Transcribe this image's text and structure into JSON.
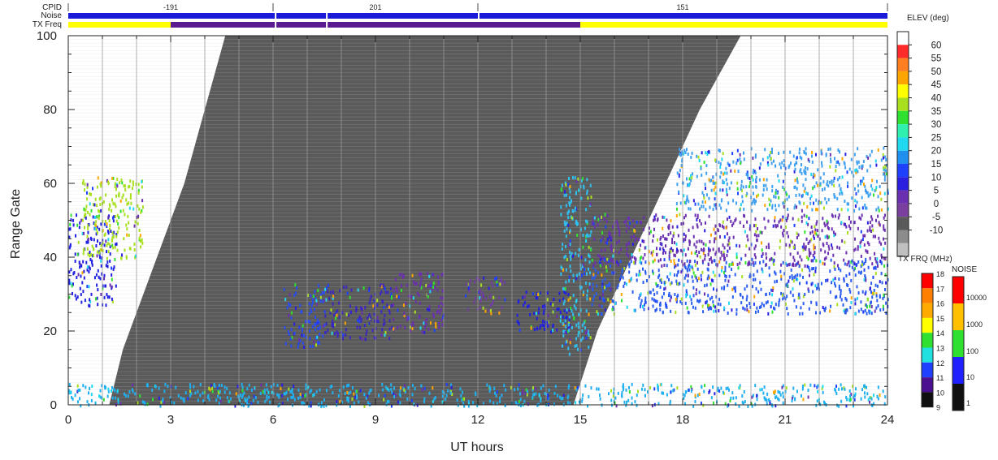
{
  "chart_data": {
    "type": "heatmap",
    "title": "",
    "xlabel": "UT hours",
    "ylabel": "Range Gate",
    "xlim": [
      0,
      24
    ],
    "ylim": [
      0,
      100
    ],
    "x_ticks": [
      "0",
      "3",
      "6",
      "9",
      "12",
      "15",
      "18",
      "21",
      "24"
    ],
    "y_ticks": [
      "0",
      "20",
      "40",
      "60",
      "80",
      "100"
    ],
    "grid": "vertical lines every hour",
    "status_strips": {
      "labels": [
        "CPID",
        "Noise",
        "TX Freq"
      ],
      "cpid_segments": [
        {
          "start": 0,
          "end": 6,
          "label": "-191"
        },
        {
          "start": 6,
          "end": 12,
          "label": "201"
        },
        {
          "start": 12,
          "end": 24,
          "label": "151"
        }
      ]
    },
    "gray_region": {
      "description_free": true,
      "left_edge": [
        [
          1.2,
          0
        ],
        [
          1.6,
          15
        ],
        [
          2.2,
          30
        ],
        [
          2.8,
          45
        ],
        [
          3.4,
          60
        ],
        [
          4.0,
          80
        ],
        [
          4.6,
          100
        ]
      ],
      "right_edge": [
        [
          14.8,
          0
        ],
        [
          15.5,
          20
        ],
        [
          16.5,
          40
        ],
        [
          17.5,
          60
        ],
        [
          18.5,
          80
        ],
        [
          19.7,
          100
        ]
      ]
    },
    "echo_regions": [
      {
        "t0": 0.0,
        "t1": 1.4,
        "g0": 27,
        "g1": 52,
        "color": "#2020e0"
      },
      {
        "t0": 0.4,
        "t1": 2.2,
        "g0": 40,
        "g1": 62,
        "color": "#a8e020"
      },
      {
        "t0": 6.3,
        "t1": 7.5,
        "g0": 16,
        "g1": 33,
        "color": "#2a4cf0"
      },
      {
        "t0": 7.5,
        "t1": 9.5,
        "g0": 18,
        "g1": 33,
        "color": "#3a28c0"
      },
      {
        "t0": 9.5,
        "t1": 11.0,
        "g0": 20,
        "g1": 36,
        "color": "#6a30b0"
      },
      {
        "t0": 11.6,
        "t1": 12.8,
        "g0": 25,
        "g1": 35,
        "color": "#7040a0"
      },
      {
        "t0": 13.1,
        "t1": 14.7,
        "g0": 20,
        "g1": 31,
        "color": "#2020e0"
      },
      {
        "t0": 14.4,
        "t1": 15.3,
        "g0": 14,
        "g1": 63,
        "color": "#30c0f0"
      },
      {
        "t0": 15.3,
        "t1": 24.0,
        "g0": 25,
        "g1": 40,
        "color": "#2a5cf0"
      },
      {
        "t0": 15.3,
        "t1": 24.0,
        "g0": 38,
        "g1": 52,
        "color": "#6a30b0"
      },
      {
        "t0": 17.8,
        "t1": 24.0,
        "g0": 53,
        "g1": 70,
        "color": "#40a0f0"
      },
      {
        "t0": 0.0,
        "t1": 24.0,
        "g0": 0,
        "g1": 6,
        "color": "#20b0f0"
      }
    ],
    "elevation_colorbar": {
      "label": "ELEV (deg)",
      "ticks": [
        "60",
        "55",
        "50",
        "45",
        "40",
        "35",
        "30",
        "25",
        "20",
        "15",
        "10",
        "5",
        "0",
        "-5",
        "-10"
      ],
      "colors": [
        "#ffffff",
        "#ff2a2a",
        "#ff7f20",
        "#ffa500",
        "#ffff00",
        "#a8e020",
        "#30e030",
        "#30f0b0",
        "#20d8f0",
        "#2090f0",
        "#1e40ff",
        "#2a1ee0",
        "#6a30b0",
        "#7a40a0",
        "#5a5a5a",
        "#8c8c8c",
        "#c0c0c0"
      ]
    },
    "txfreq_colorbar": {
      "label": "TX FRQ (MHz)",
      "ticks": [
        "18",
        "17",
        "16",
        "15",
        "14",
        "13",
        "12",
        "11",
        "10",
        "9"
      ],
      "colors": [
        "#ff0000",
        "#ff7f00",
        "#ffaa00",
        "#ffff00",
        "#30e030",
        "#20e0e0",
        "#2040ff",
        "#4a1090",
        "#101010"
      ]
    },
    "noise_colorbar": {
      "label": "NOISE",
      "ticks": [
        "10000",
        "1000",
        "100",
        "10",
        "1"
      ],
      "colors": [
        "#ff0000",
        "#ffc000",
        "#30e030",
        "#2020ff",
        "#101010"
      ]
    }
  }
}
